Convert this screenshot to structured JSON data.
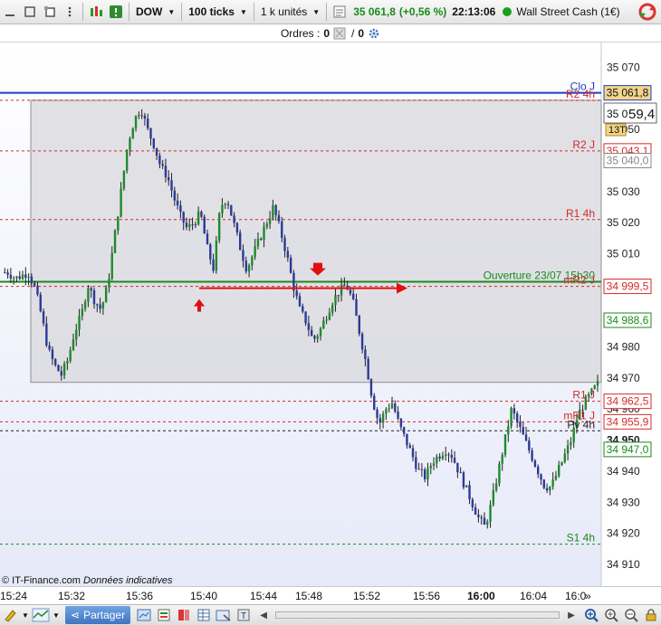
{
  "toolbar": {
    "instrument": "DOW",
    "period": "100 ticks",
    "size": "1 k unités",
    "price": "35 061,8",
    "change": "(+0,56 %)",
    "time": "22:13:06",
    "market": "Wall Street Cash (1€)"
  },
  "orders": {
    "label": "Ordres :",
    "count": "0",
    "sep": "/",
    "count2": "0"
  },
  "axis": {
    "ticks": [
      "35 070",
      "35 050",
      "35 030",
      "35 020",
      "35 010",
      "34 980",
      "34 970",
      "34 960",
      "34 950",
      "34 940",
      "34 930",
      "34 920",
      "34 910"
    ],
    "time_labels": [
      "15:24",
      "15:32",
      "15:36",
      "15:40",
      "15:44",
      "15:48",
      "15:52",
      "15:56",
      "16:00",
      "16:04",
      "16:0"
    ],
    "current_price_box": "35 061,8",
    "current_price_partial": "35 0",
    "current_price_big": "59,4",
    "countdown": "13T"
  },
  "levels": [
    {
      "label": "Clo J",
      "price": 35061.8,
      "box": "35 061,8",
      "color": "#1a3fc4",
      "style": "solid"
    },
    {
      "label": "R2 4h",
      "price": 35059.4,
      "box": "",
      "color": "#d42a2a",
      "style": "dashed"
    },
    {
      "label": "R2 J",
      "price": 35043.1,
      "box": "35 043,1",
      "color": "#d42a2a",
      "style": "dashed"
    },
    {
      "label": "",
      "price": 35040.0,
      "box": "35 040,0",
      "color": "#888888",
      "style": "none"
    },
    {
      "label": "R1 4h",
      "price": 35021.0,
      "box": "",
      "color": "#d42a2a",
      "style": "dashed"
    },
    {
      "label": "Ouverture 23/07 15h30",
      "price": 35001.0,
      "box": "",
      "color": "#1c8a1c",
      "style": "solid"
    },
    {
      "label": "mR2 J",
      "price": 34999.5,
      "box": "34 999,5",
      "color": "#d42a2a",
      "style": "dashed"
    },
    {
      "label": "",
      "price": 34988.6,
      "box": "34 988,6",
      "color": "#1c8a1c",
      "style": "none"
    },
    {
      "label": "R1 J",
      "price": 34962.5,
      "box": "34 962,5",
      "color": "#d42a2a",
      "style": "dashed"
    },
    {
      "label": "mR1 J",
      "price": 34955.9,
      "box": "34 955,9",
      "color": "#d42a2a",
      "style": "dashed"
    },
    {
      "label": "Pv 4h",
      "price": 34953.0,
      "box": "",
      "color": "#222222",
      "style": "dashed"
    },
    {
      "label": "",
      "price": 34947.0,
      "box": "34 947,0",
      "color": "#1c8a1c",
      "style": "none"
    },
    {
      "label": "S1 4h",
      "price": 34916.5,
      "box": "",
      "color": "#1c8a1c",
      "style": "dashed"
    }
  ],
  "copyright": "© IT-Finance.com",
  "disclaimer": "Données indicatives",
  "bottom": {
    "share": "Partager"
  },
  "chart_data": {
    "type": "candlestick",
    "ylim": [
      34903,
      35078
    ],
    "x": [
      "15:24",
      "15:32",
      "15:36",
      "15:40",
      "15:44",
      "15:48",
      "15:52",
      "15:56",
      "16:00",
      "16:04"
    ],
    "close_path": [
      35004,
      35004,
      35002,
      35003,
      35004,
      34999,
      34990,
      34979,
      34974,
      34971,
      34976,
      34985,
      34990,
      35000,
      34995,
      34992,
      35000,
      35015,
      35030,
      35045,
      35053,
      35057,
      35050,
      35045,
      35038,
      35035,
      35028,
      35022,
      35018,
      35020,
      35023,
      35012,
      35005,
      35025,
      35028,
      35020,
      35012,
      35005,
      35010,
      35015,
      35020,
      35025,
      35018,
      35010,
      35000,
      34992,
      34988,
      34982,
      34985,
      34990,
      34995,
      34998,
      35000,
      34995,
      34985,
      34975,
      34963,
      34955,
      34960,
      34962,
      34955,
      34950,
      34945,
      34940,
      34938,
      34943,
      34945,
      34947,
      34945,
      34940,
      34935,
      34930,
      34925,
      34922,
      34930,
      34940,
      34950,
      34960,
      34955,
      34950,
      34945,
      34940,
      34935,
      34935,
      34940,
      34945,
      34950,
      34958,
      34962,
      34965,
      34968
    ]
  }
}
